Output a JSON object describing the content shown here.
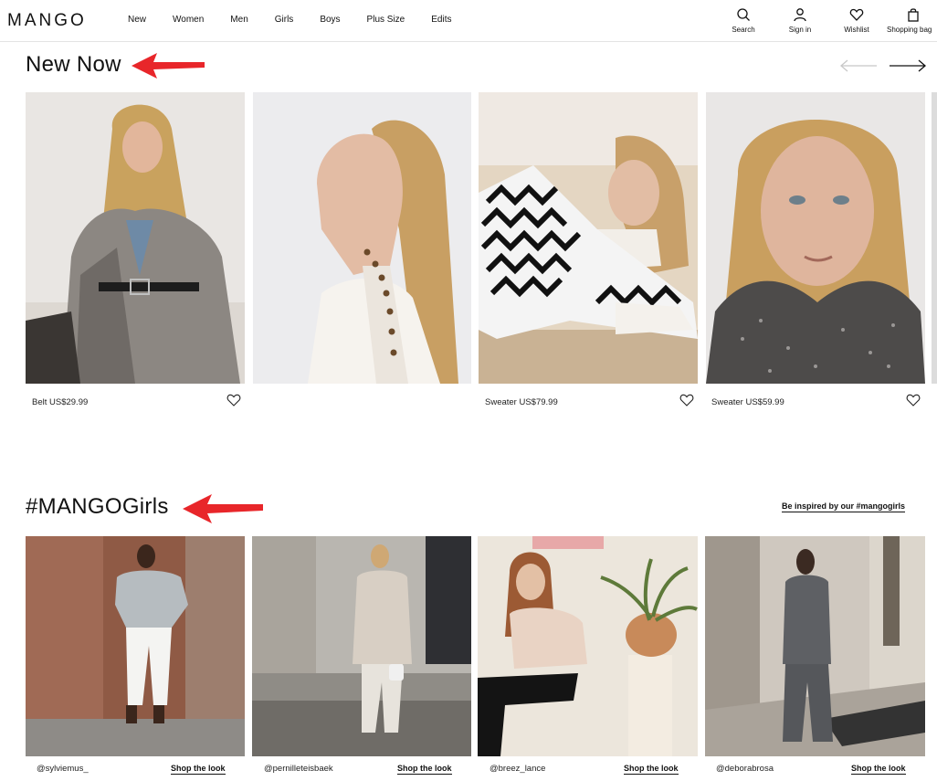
{
  "header": {
    "logo": "MANGO",
    "nav": [
      "New",
      "Women",
      "Men",
      "Girls",
      "Boys",
      "Plus Size",
      "Edits"
    ],
    "actions": [
      {
        "label": "Search",
        "icon": "search-icon"
      },
      {
        "label": "Sign in",
        "icon": "user-icon"
      },
      {
        "label": "Wishlist",
        "icon": "heart-icon"
      },
      {
        "label": "Shopping bag",
        "icon": "bag-icon"
      }
    ]
  },
  "new_now": {
    "title": "New Now",
    "products": [
      {
        "caption": "Belt US$29.99",
        "image": "model-houndstooth-blazer-photo"
      },
      {
        "caption": "",
        "image": "model-white-sweater-profile-photo"
      },
      {
        "caption": "Sweater US$79.99",
        "image": "model-zigzag-sweater-photo"
      },
      {
        "caption": "Sweater US$59.99",
        "image": "model-tweed-scarf-photo"
      }
    ]
  },
  "mango_girls": {
    "title": "#MANGOGirls",
    "inspired_link": "Be inspired by our #mangogirls",
    "looks": [
      {
        "handle": "@sylviemus_",
        "cta": "Shop the look"
      },
      {
        "handle": "@pernilleteisbaek",
        "cta": "Shop the look"
      },
      {
        "handle": "@breez_lance",
        "cta": "Shop the look"
      },
      {
        "handle": "@deborabrosa",
        "cta": "Shop the look"
      }
    ]
  },
  "colors": {
    "annotation_arrow": "#e8262a",
    "text": "#111111"
  }
}
